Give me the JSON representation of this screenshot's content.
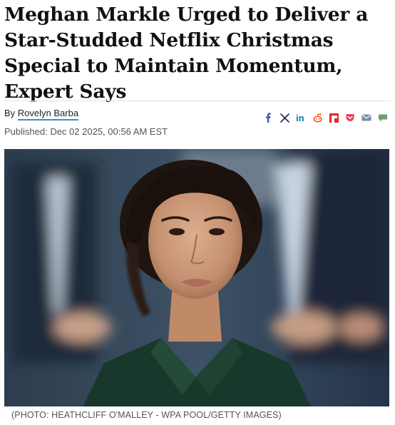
{
  "article": {
    "headline": "Meghan Markle Urged to Deliver a Star-Studded Netflix Christmas Special to Maintain Momentum, Expert Says",
    "byline_prefix": "By",
    "author": "Rovelyn Barba",
    "published": "Published: Dec 02 2025, 00:56 AM EST",
    "photo_caption": "(PHOTO: HEATHCLIFF O'MALLEY - WPA POOL/GETTY IMAGES)"
  },
  "share_icons": [
    {
      "name": "facebook-icon",
      "color": "#3b5998"
    },
    {
      "name": "x-icon",
      "color": "#1a2b4c"
    },
    {
      "name": "linkedin-icon",
      "color": "#0077b5"
    },
    {
      "name": "reddit-icon",
      "color": "#ff4500"
    },
    {
      "name": "flipboard-icon",
      "color": "#e12828"
    },
    {
      "name": "pocket-icon",
      "color": "#ef4056"
    },
    {
      "name": "email-icon",
      "color": "#7a8ea3"
    },
    {
      "name": "comment-icon",
      "color": "#6a9e6a"
    }
  ],
  "colors": {
    "author_underline": "#2d8fd5"
  }
}
